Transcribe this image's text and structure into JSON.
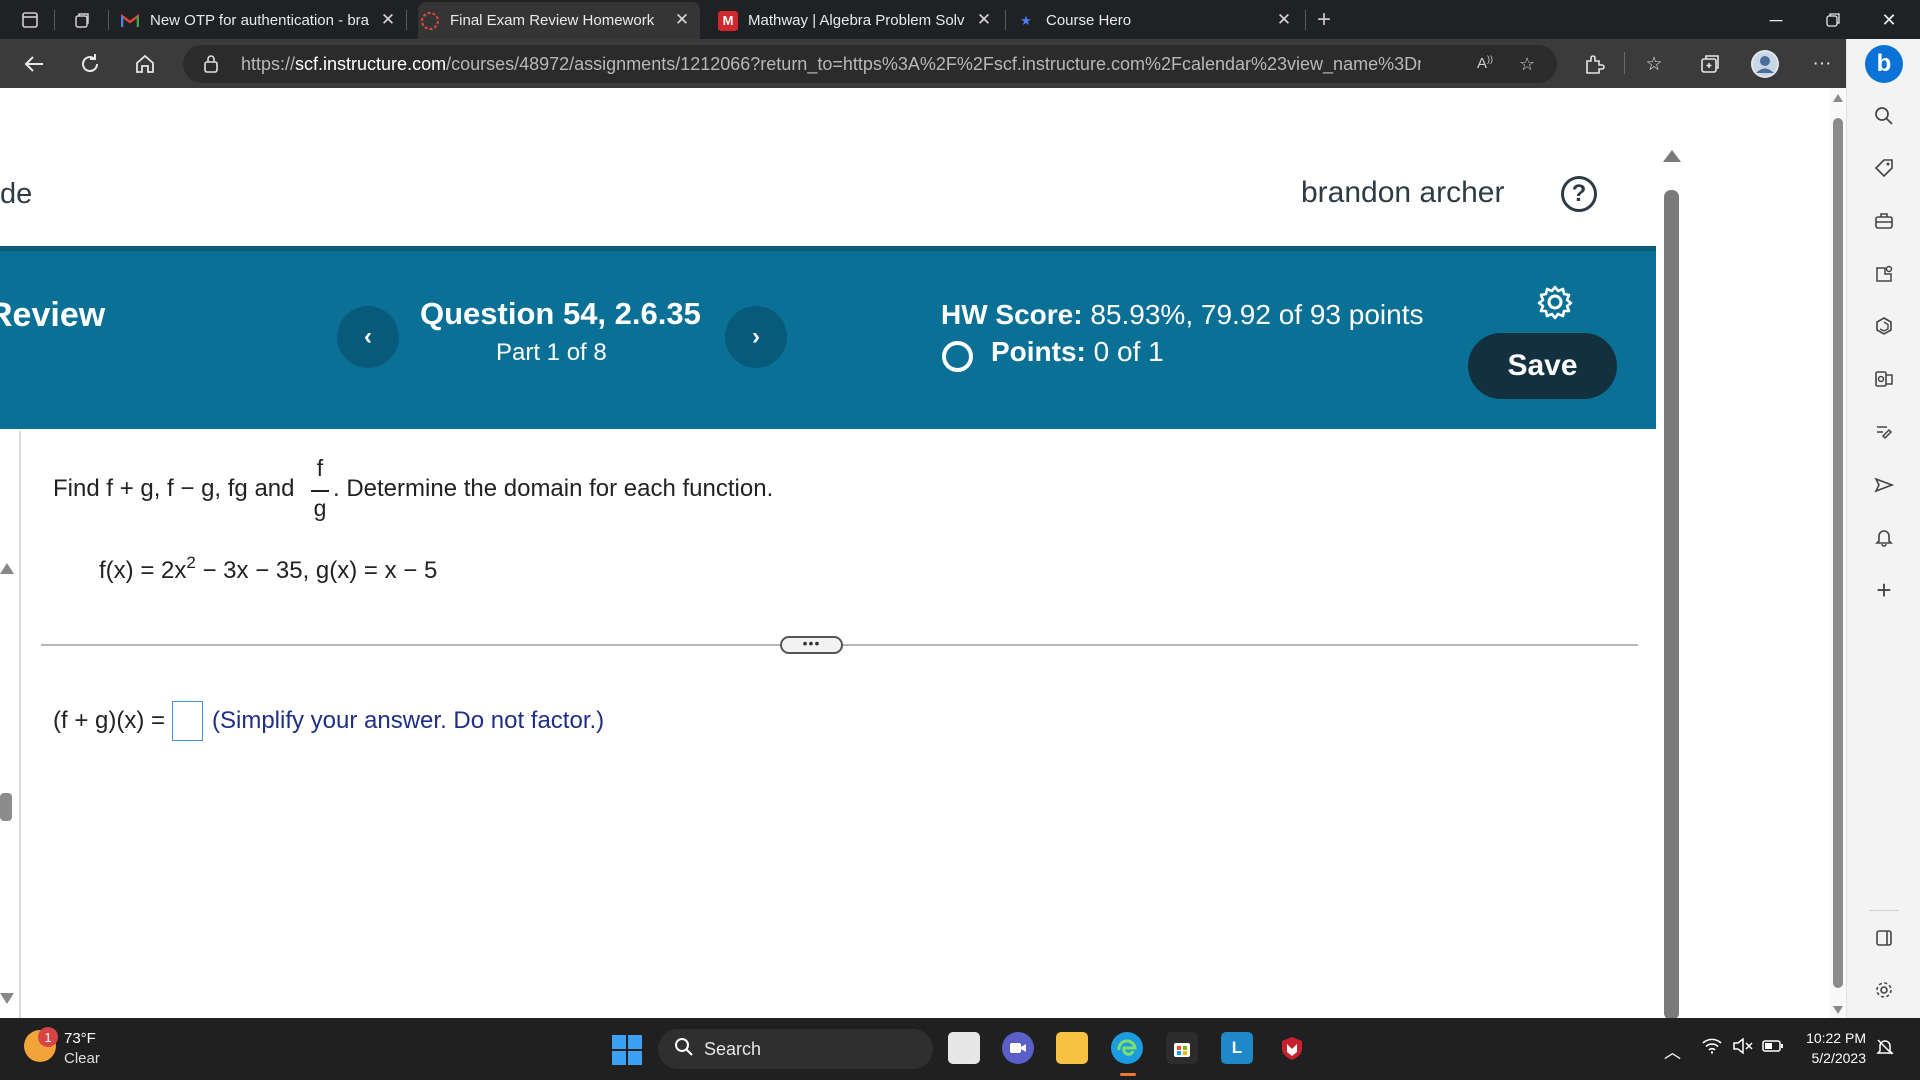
{
  "browser": {
    "tabs": [
      {
        "title": "New OTP for authentication - bra",
        "favicon": "gmail-icon"
      },
      {
        "title": "Final Exam Review Homework",
        "favicon": "pearson-icon"
      },
      {
        "title": "Mathway | Algebra Problem Solv",
        "favicon": "mathway-icon"
      },
      {
        "title": "Course Hero",
        "favicon": "star-icon"
      }
    ],
    "url_prefix": "https://",
    "url_host": "scf.instructure.com",
    "url_path": "/courses/48972/assignments/1212066?return_to=https%3A%2F%2Fscf.instructure.com%2Fcalendar%23view_name%3Dmonth%26...",
    "read_aloud_label": "A̒"
  },
  "page": {
    "brand_fragment": "de",
    "user_name": "brandon archer",
    "help_symbol": "?",
    "banner": {
      "title_fragment": "Review",
      "prev_symbol": "‹",
      "next_symbol": "›",
      "question_title": "Question 54, 2.6.35",
      "question_part": "Part 1 of 8",
      "hw_score_label": "HW Score:",
      "hw_score_value": " 85.93%, 79.92 of 93 points",
      "points_label": "Points:",
      "points_value": " 0 of 1",
      "save_label": "Save"
    },
    "problem": {
      "instruction_start": "Find f + g, f − g, fg and",
      "fraction_num": "f",
      "fraction_den": "g",
      "instruction_end": ".  Determine the domain for each function.",
      "f_def_start": "f(x) = 2x",
      "f_def_exp": "2",
      "f_def_end": " − 3x − 35, g(x) = x − 5",
      "expand_symbol": "•••",
      "answer_label": "(f + g)(x) =",
      "answer_value": "",
      "answer_hint": "(Simplify your answer. Do not factor.)"
    }
  },
  "taskbar": {
    "notification_count": "1",
    "temperature": "73°F",
    "condition": "Clear",
    "search_label": "Search",
    "time": "10:22 PM",
    "date": "5/2/2023"
  },
  "colors": {
    "banner": "#0b7096",
    "save_button": "#13303f",
    "answer_hint": "#1f2e86"
  }
}
